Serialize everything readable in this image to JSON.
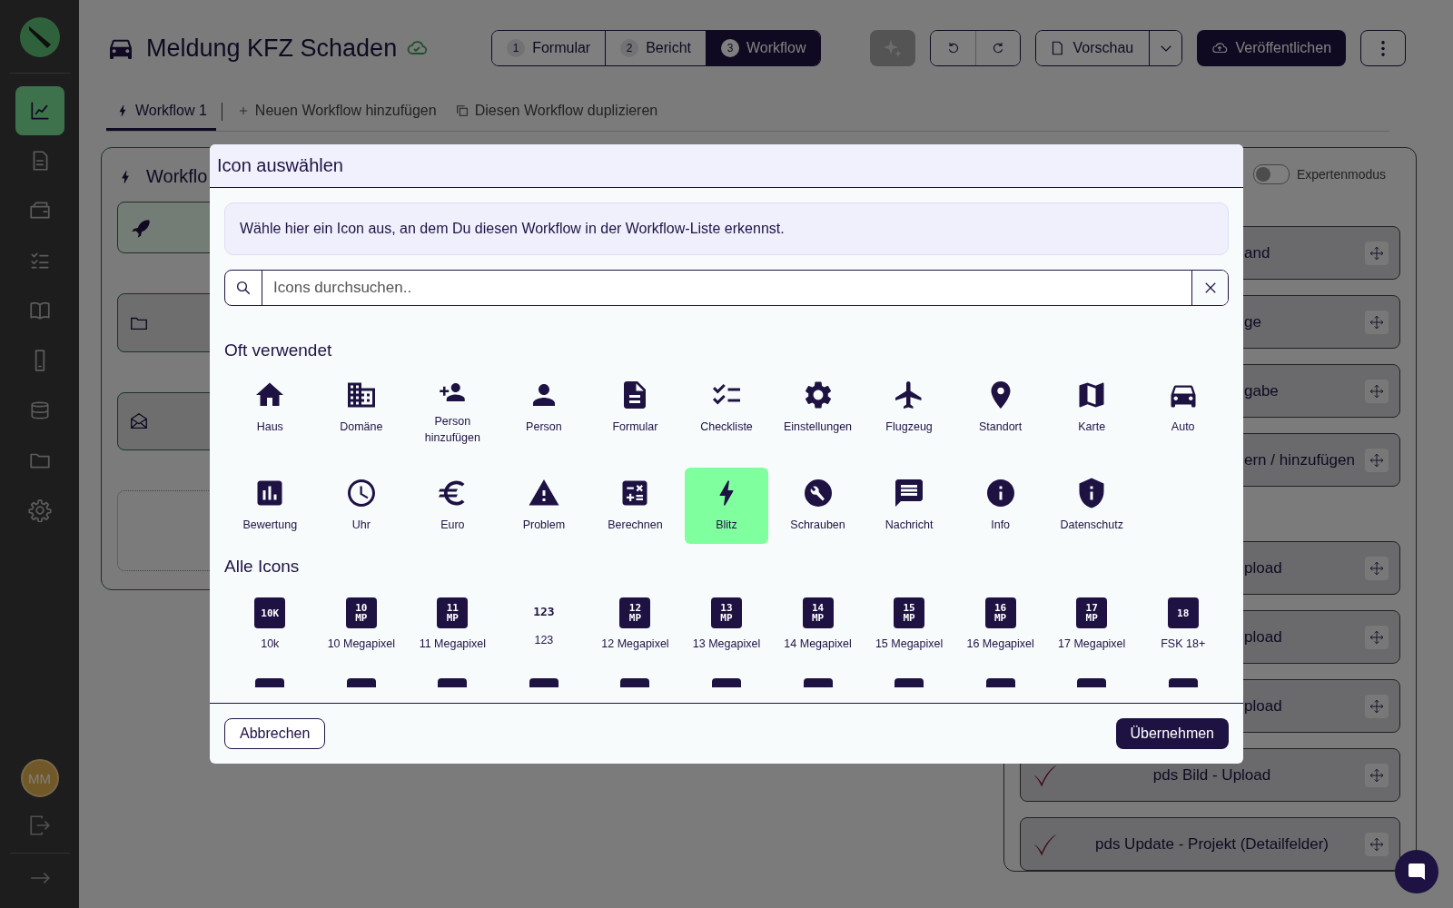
{
  "sidebar": {
    "nav": [
      {
        "selected": true
      },
      {
        "selected": false
      },
      {
        "selected": false
      },
      {
        "selected": false
      },
      {
        "selected": false
      },
      {
        "selected": false
      },
      {
        "selected": false
      },
      {
        "selected": false
      },
      {
        "selected": false
      }
    ],
    "avatar": "MM"
  },
  "header": {
    "title": "Meldung KFZ Schaden",
    "steps": [
      {
        "number": "1",
        "label": "Formular",
        "selected": false
      },
      {
        "number": "2",
        "label": "Bericht",
        "selected": false
      },
      {
        "number": "3",
        "label": "Workflow",
        "selected": true
      }
    ],
    "preview": "Vorschau",
    "publish": "Veröffentlichen"
  },
  "tabs": [
    {
      "label": "Workflow 1",
      "kind": "workflow",
      "selected": true
    },
    {
      "label": "Neuen Workflow hinzufügen",
      "kind": "add",
      "selected": false
    },
    {
      "label": "Diesen Workflow duplizieren",
      "kind": "duplicate",
      "selected": false
    }
  ],
  "workflow_card": {
    "title": "Workflo",
    "nodes": [
      {
        "kind": "start"
      },
      {
        "kind": "folder"
      },
      {
        "kind": "mail"
      },
      {
        "kind": "empty"
      }
    ]
  },
  "steps_panel": {
    "expert_mode": {
      "label": "Expertenmodus",
      "on": false
    },
    "groups": [
      [
        {
          "label": "and",
          "kind": "covered"
        },
        {
          "label": "ge",
          "kind": "covered"
        },
        {
          "label": "gabe",
          "kind": "covered"
        },
        {
          "label": "ern / hinzufügen",
          "kind": "covered"
        }
      ],
      [
        {
          "label": "pload",
          "kind": "covered"
        },
        {
          "label": "pload",
          "kind": "covered"
        },
        {
          "label": "pload",
          "kind": "covered"
        },
        {
          "label": "pds Bild - Upload",
          "kind": "full"
        },
        {
          "label": "pds Update - Projekt (Detailfelder)",
          "kind": "full"
        }
      ]
    ]
  },
  "modal": {
    "title": "Icon auswählen",
    "hint": "Wähle hier ein Icon aus, an dem Du diesen Workflow in der Workflow-Liste erkennst.",
    "search": {
      "placeholder": "Icons durchsuchen.."
    },
    "sections": [
      {
        "title": "Oft verwendet",
        "kind": "frequent",
        "icons": [
          {
            "label": "Haus",
            "selected": false
          },
          {
            "label": "Domäne",
            "selected": false
          },
          {
            "label": "Person hinzufügen",
            "selected": false
          },
          {
            "label": "Person",
            "selected": false
          },
          {
            "label": "Formular",
            "selected": false
          },
          {
            "label": "Checkliste",
            "selected": false
          },
          {
            "label": "Einstellungen",
            "selected": false
          },
          {
            "label": "Flugzeug",
            "selected": false
          },
          {
            "label": "Standort",
            "selected": false
          },
          {
            "label": "Karte",
            "selected": false
          },
          {
            "label": "Auto",
            "selected": false
          },
          {
            "label": "Bewertung",
            "selected": false
          },
          {
            "label": "Uhr",
            "selected": false
          },
          {
            "label": "Euro",
            "selected": false
          },
          {
            "label": "Problem",
            "selected": false
          },
          {
            "label": "Berechnen",
            "selected": false
          },
          {
            "label": "Blitz",
            "selected": true
          },
          {
            "label": "Schrauben",
            "selected": false
          },
          {
            "label": "Nachricht",
            "selected": false
          },
          {
            "label": "Info",
            "selected": false
          },
          {
            "label": "Datenschutz",
            "selected": false
          }
        ]
      },
      {
        "title": "Alle Icons",
        "kind": "all",
        "icons": [
          {
            "label": "10k",
            "glyph": [
              "10K"
            ],
            "kind": "badge",
            "selected": false
          },
          {
            "label": "10 Megapixel",
            "glyph": [
              "10",
              "MP"
            ],
            "kind": "badge",
            "selected": false
          },
          {
            "label": "11 Megapixel",
            "glyph": [
              "11",
              "MP"
            ],
            "kind": "badge",
            "selected": false
          },
          {
            "label": "123",
            "glyph": [
              "123"
            ],
            "kind": "plain",
            "selected": false
          },
          {
            "label": "12 Megapixel",
            "glyph": [
              "12",
              "MP"
            ],
            "kind": "badge",
            "selected": false
          },
          {
            "label": "13 Megapixel",
            "glyph": [
              "13",
              "MP"
            ],
            "kind": "badge",
            "selected": false
          },
          {
            "label": "14 Megapixel",
            "glyph": [
              "14",
              "MP"
            ],
            "kind": "badge",
            "selected": false
          },
          {
            "label": "15 Megapixel",
            "glyph": [
              "15",
              "MP"
            ],
            "kind": "badge",
            "selected": false
          },
          {
            "label": "16 Megapixel",
            "glyph": [
              "16",
              "MP"
            ],
            "kind": "badge",
            "selected": false
          },
          {
            "label": "17 Megapixel",
            "glyph": [
              "17",
              "MP"
            ],
            "kind": "badge",
            "selected": false
          },
          {
            "label": "FSK 18+",
            "glyph": [
              "18"
            ],
            "kind": "badge",
            "selected": false
          }
        ]
      }
    ],
    "cancel": "Abbrechen",
    "apply": "Übernehmen"
  }
}
